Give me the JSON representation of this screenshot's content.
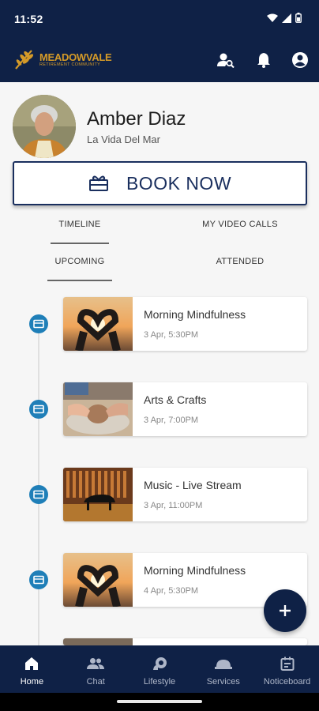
{
  "status_bar": {
    "time": "11:52",
    "icons": [
      "wifi-icon",
      "signal-icon",
      "battery-icon"
    ]
  },
  "app_bar": {
    "logo_name": "MEADOWVALE",
    "logo_subtitle": "RETIREMENT COMMUNITY",
    "actions": [
      "person-search-icon",
      "bell-icon",
      "account-icon"
    ]
  },
  "profile": {
    "name": "Amber Diaz",
    "community": "La Vida Del Mar"
  },
  "book_button": {
    "label": "BOOK NOW",
    "icon": "gift-icon"
  },
  "tabs": [
    {
      "label": "TIMELINE",
      "selected": true
    },
    {
      "label": "MY VIDEO CALLS",
      "selected": false
    }
  ],
  "subtabs": [
    {
      "label": "UPCOMING",
      "selected": true
    },
    {
      "label": "ATTENDED",
      "selected": false
    }
  ],
  "events": [
    {
      "title": "Morning Mindfulness",
      "when": "3 Apr, 5:30PM",
      "image": "hands-heart-sunset"
    },
    {
      "title": "Arts & Crafts",
      "when": "3 Apr, 7:00PM",
      "image": "pottery-wheel"
    },
    {
      "title": "Music - Live Stream",
      "when": "3 Apr, 11:00PM",
      "image": "piano-stage"
    },
    {
      "title": "Morning Mindfulness",
      "when": "4 Apr, 5:30PM",
      "image": "hands-heart-sunset"
    }
  ],
  "fab": {
    "icon": "plus-icon"
  },
  "bottom_nav": [
    {
      "label": "Home",
      "icon": "home-icon",
      "active": true
    },
    {
      "label": "Chat",
      "icon": "people-icon",
      "active": false
    },
    {
      "label": "Lifestyle",
      "icon": "lifestyle-icon",
      "active": false
    },
    {
      "label": "Services",
      "icon": "services-icon",
      "active": false
    },
    {
      "label": "Noticeboard",
      "icon": "noticeboard-icon",
      "active": false
    }
  ],
  "colors": {
    "navy": "#0f2146",
    "accent_blue": "#1f7fb8",
    "gold": "#d49a28",
    "button_text": "#1a2f5e"
  }
}
